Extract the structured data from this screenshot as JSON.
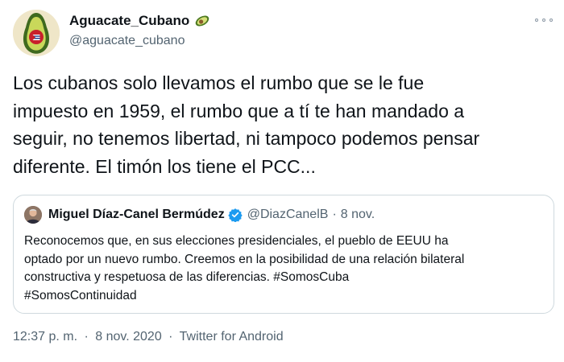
{
  "author": {
    "name": "Aguacate_Cubano",
    "handle": "@aguacate_cubano",
    "name_emoji_icon": "avocado-icon",
    "avatar_icon": "avocado-cuban-flag-avatar"
  },
  "more_icon": "more-options-icon",
  "tweet": {
    "lines": [
      "Los cubanos solo llevamos el rumbo que se le fue",
      "impuesto en 1959, el rumbo que a tí te han mandado a",
      "seguir, no tenemos libertad, ni tampoco podemos pensar",
      "diferente. El timón los tiene el PCC..."
    ]
  },
  "quote": {
    "name": "Miguel Díaz-Canel Bermúdez",
    "verified_icon": "verified-badge-icon",
    "verified_color": "#1d9bf0",
    "handle": "@DiazCanelB",
    "separator": "·",
    "date": "8 nov.",
    "lines": [
      "Reconocemos que, en sus elecciones presidenciales, el pueblo de EEUU ha",
      "optado por un nuevo rumbo. Creemos en la posibilidad de una relación bilateral",
      "constructiva y respetuosa de las diferencias. #SomosCuba",
      "#SomosContinuidad"
    ]
  },
  "meta": {
    "time": "12:37 p. m.",
    "separator": "·",
    "date": "8 nov. 2020",
    "source": "Twitter for Android"
  },
  "colors": {
    "text": "#0f1419",
    "secondary": "#536471",
    "border": "#cfd9de"
  }
}
